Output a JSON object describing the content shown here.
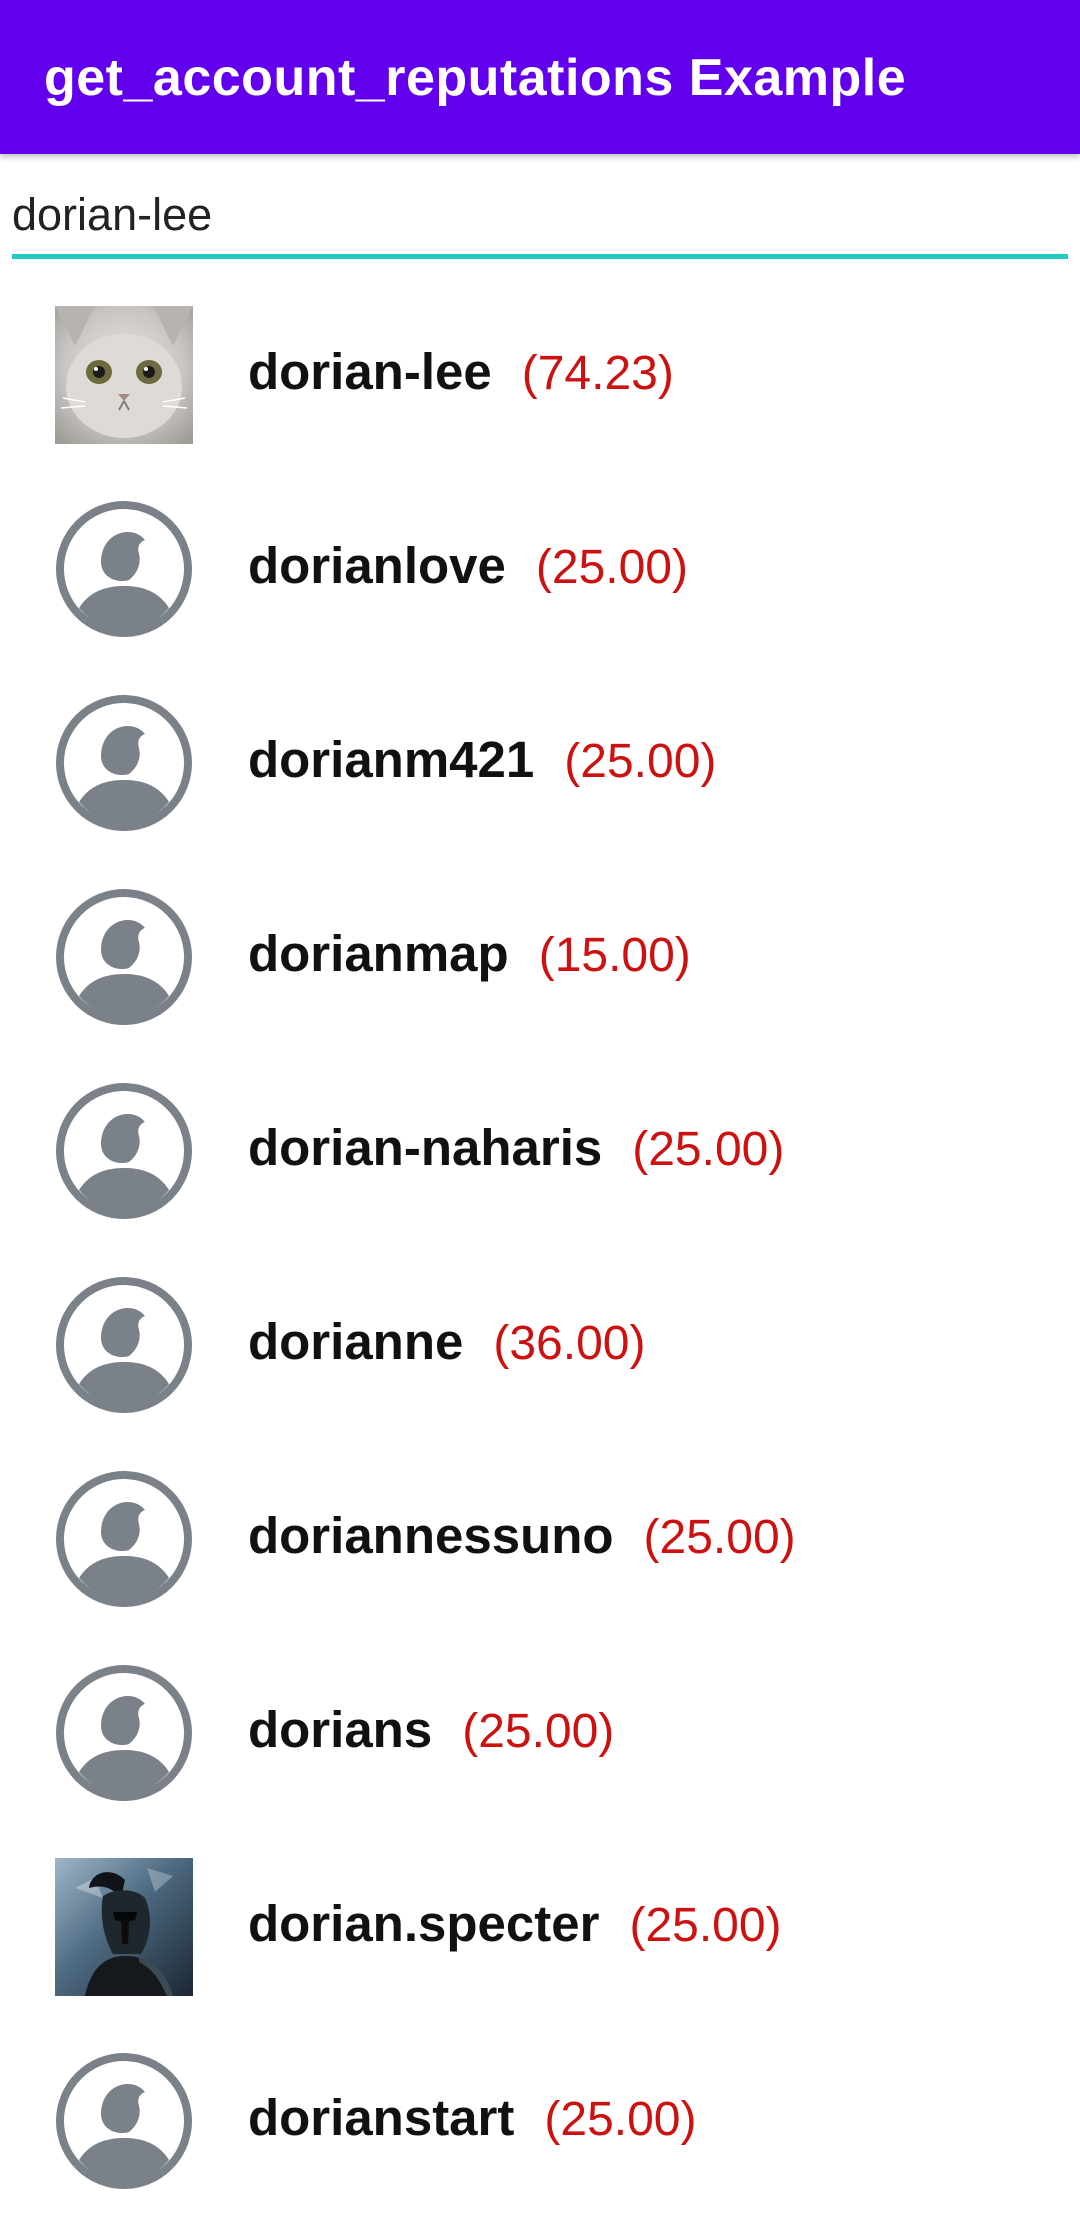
{
  "app_bar": {
    "title": "get_account_reputations Example",
    "background_color": "#6200ee"
  },
  "search": {
    "value": "dorian-lee",
    "underline_color": "#1fcbc3"
  },
  "colors": {
    "reputation": "#cc1111",
    "default_avatar": "#7b8189"
  },
  "accounts": [
    {
      "name": "dorian-lee",
      "reputation": "(74.23)",
      "avatar": "cat-photo-avatar"
    },
    {
      "name": "dorianlove",
      "reputation": "(25.00)",
      "avatar": "default-user-icon"
    },
    {
      "name": "dorianm421",
      "reputation": "(25.00)",
      "avatar": "default-user-icon"
    },
    {
      "name": "dorianmap",
      "reputation": "(15.00)",
      "avatar": "default-user-icon"
    },
    {
      "name": "dorian-naharis",
      "reputation": "(25.00)",
      "avatar": "default-user-icon"
    },
    {
      "name": "dorianne",
      "reputation": "(36.00)",
      "avatar": "default-user-icon"
    },
    {
      "name": "doriannessuno",
      "reputation": "(25.00)",
      "avatar": "default-user-icon"
    },
    {
      "name": "dorians",
      "reputation": "(25.00)",
      "avatar": "default-user-icon"
    },
    {
      "name": "dorian.specter",
      "reputation": "(25.00)",
      "avatar": "spartan-photo-avatar"
    },
    {
      "name": "dorianstart",
      "reputation": "(25.00)",
      "avatar": "default-user-icon"
    }
  ]
}
